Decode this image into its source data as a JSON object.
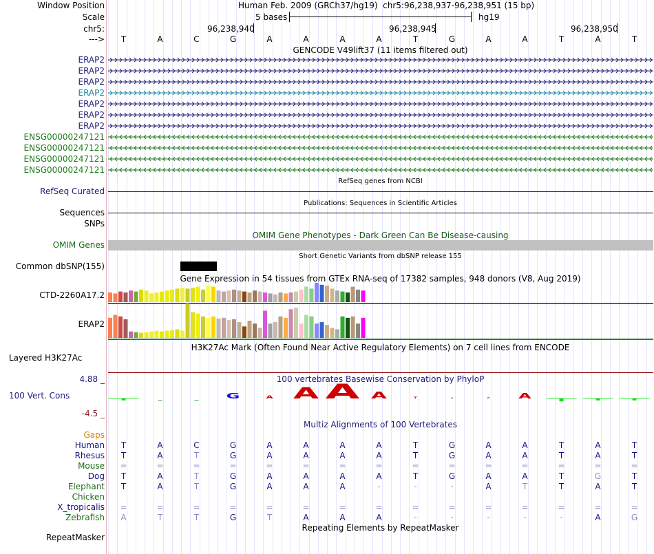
{
  "header": {
    "window_position_label": "Window Position",
    "scale_label": "Scale",
    "chrom_label": "chr5:",
    "strand_label": "--->",
    "assembly_text": "Human Feb. 2009 (GRCh37/hg19)",
    "position_text": "chr5:96,238,937-96,238,951 (15 bp)",
    "scale_text": "5 bases",
    "db_text": "hg19",
    "ruler_ticks": [
      "96,238,940",
      "96,238,945",
      "96,238,950"
    ]
  },
  "sequence": [
    "T",
    "A",
    "C",
    "G",
    "A",
    "A",
    "A",
    "A",
    "T",
    "G",
    "A",
    "A",
    "T",
    "A",
    "T"
  ],
  "gencode": {
    "title": "GENCODE V49lift37 (11 items filtered out)",
    "rows": [
      {
        "name": "ERAP2",
        "color": "#20207a",
        "strand": "+"
      },
      {
        "name": "ERAP2",
        "color": "#20207a",
        "strand": "+"
      },
      {
        "name": "ERAP2",
        "color": "#20207a",
        "strand": "+"
      },
      {
        "name": "ERAP2",
        "color": "#1a86a3",
        "strand": "+"
      },
      {
        "name": "ERAP2",
        "color": "#20207a",
        "strand": "+"
      },
      {
        "name": "ERAP2",
        "color": "#20207a",
        "strand": "+"
      },
      {
        "name": "ERAP2",
        "color": "#20207a",
        "strand": "+"
      },
      {
        "name": "ENSG00000247121",
        "color": "#1c7a1c",
        "strand": "-"
      },
      {
        "name": "ENSG00000247121",
        "color": "#1c7a1c",
        "strand": "-"
      },
      {
        "name": "ENSG00000247121",
        "color": "#1c7a1c",
        "strand": "-"
      },
      {
        "name": "ENSG00000247121",
        "color": "#1c7a1c",
        "strand": "-"
      }
    ]
  },
  "refseq": {
    "label": "RefSeq Curated",
    "title": "RefSeq genes from NCBI"
  },
  "pubs": {
    "label": "Sequences",
    "title": "Publications: Sequences in Scientific Articles"
  },
  "snps": {
    "label": "SNPs"
  },
  "omim": {
    "label": "OMIM Genes",
    "title": "OMIM Gene Phenotypes - Dark Green Can Be Disease-causing"
  },
  "dbsnp": {
    "label": "Common dbSNP(155)",
    "title": "Short Genetic Variants from dbSNP release 155"
  },
  "gtex": {
    "title": "Gene Expression in 54 tissues from GTEx RNA-seq of 17382 samples, 948 donors (V8, Aug 2019)",
    "genes": [
      {
        "name": "CTD-2260A17.2",
        "values": [
          10,
          9,
          11,
          10,
          12,
          11,
          13,
          12,
          9,
          10,
          11,
          12,
          13,
          14,
          15,
          14,
          15,
          16,
          13,
          17,
          16,
          12,
          11,
          12,
          13,
          12,
          11,
          10,
          12,
          11,
          10,
          9,
          8,
          10,
          9,
          10,
          11,
          13,
          16,
          14,
          20,
          18,
          17,
          14,
          12,
          11,
          10,
          16,
          13,
          12
        ]
      },
      {
        "name": "ERAP2",
        "values": [
          28,
          32,
          30,
          26,
          9,
          8,
          7,
          8,
          9,
          10,
          9,
          10,
          11,
          12,
          10,
          48,
          36,
          34,
          30,
          28,
          30,
          27,
          28,
          25,
          26,
          22,
          16,
          24,
          20,
          14,
          38,
          20,
          22,
          30,
          28,
          40,
          42,
          20,
          32,
          30,
          20,
          22,
          18,
          14,
          12,
          30,
          28,
          30,
          20,
          28
        ]
      }
    ]
  },
  "h3k27ac": {
    "label": "Layered H3K27Ac",
    "title": "H3K27Ac Mark (Often Found Near Active Regulatory Elements) on 7 cell lines from ENCODE"
  },
  "cons": {
    "label": "100 Vert. Cons",
    "max_label": "4.88 _",
    "min_label": "-4.5 _",
    "title": "100 vertebrates Basewise Conservation by PhyloP",
    "scores": [
      -0.4,
      0,
      0,
      0.9,
      0.5,
      1.8,
      2.4,
      1.1,
      0.3,
      0.1,
      0.2,
      0.9,
      -0.6,
      -0.4,
      -0.4
    ]
  },
  "multiz": {
    "title": "Multiz Alignments of 100 Vertebrates",
    "gaps_label": "Gaps",
    "species": [
      {
        "name": "Human",
        "color": "#141480",
        "bases": [
          "T",
          "A",
          "C",
          "G",
          "A",
          "A",
          "A",
          "A",
          "T",
          "G",
          "A",
          "A",
          "T",
          "A",
          "T"
        ]
      },
      {
        "name": "Rhesus",
        "color": "#141480",
        "bases": [
          "T",
          "A",
          "T",
          "G",
          "A",
          "A",
          "A",
          "A",
          "T",
          "G",
          "A",
          "A",
          "T",
          "A",
          "T"
        ]
      },
      {
        "name": "Mouse",
        "color": "#1c6e1c",
        "bases": [
          "=",
          "=",
          "=",
          "=",
          "=",
          "=",
          "=",
          "=",
          "=",
          "=",
          "=",
          "=",
          "=",
          "=",
          "="
        ]
      },
      {
        "name": "Dog",
        "color": "#141480",
        "bases": [
          "T",
          "A",
          "T",
          "G",
          "A",
          "A",
          "A",
          "A",
          "T",
          "G",
          "A",
          "A",
          "T",
          "G",
          "T"
        ]
      },
      {
        "name": "Elephant",
        "color": "#1c6e1c",
        "bases": [
          "T",
          "A",
          "T",
          "G",
          "A",
          "A",
          "A",
          "-",
          "-",
          "-",
          "A",
          "T",
          "T",
          "A",
          "T"
        ]
      },
      {
        "name": "Chicken",
        "color": "#1c6e1c",
        "bases": [
          "",
          "",
          "",
          "",
          "",
          "",
          "",
          "",
          "",
          "",
          "",
          "",
          "",
          "",
          ""
        ]
      },
      {
        "name": "X_tropicalis",
        "color": "#141480",
        "bases": [
          "=",
          "=",
          "=",
          "=",
          "=",
          "=",
          "=",
          "=",
          "=",
          "=",
          "=",
          "=",
          "=",
          "=",
          "="
        ]
      },
      {
        "name": "Zebrafish",
        "color": "#1c6e1c",
        "bases": [
          "A",
          "T",
          "T",
          "G",
          "T",
          "A",
          "A",
          "A",
          "-",
          "-",
          "-",
          "-",
          "-",
          "A",
          "G"
        ]
      }
    ]
  },
  "repeatmasker": {
    "label": "RepeatMasker",
    "title": "Repeating Elements by RepeatMasker"
  }
}
